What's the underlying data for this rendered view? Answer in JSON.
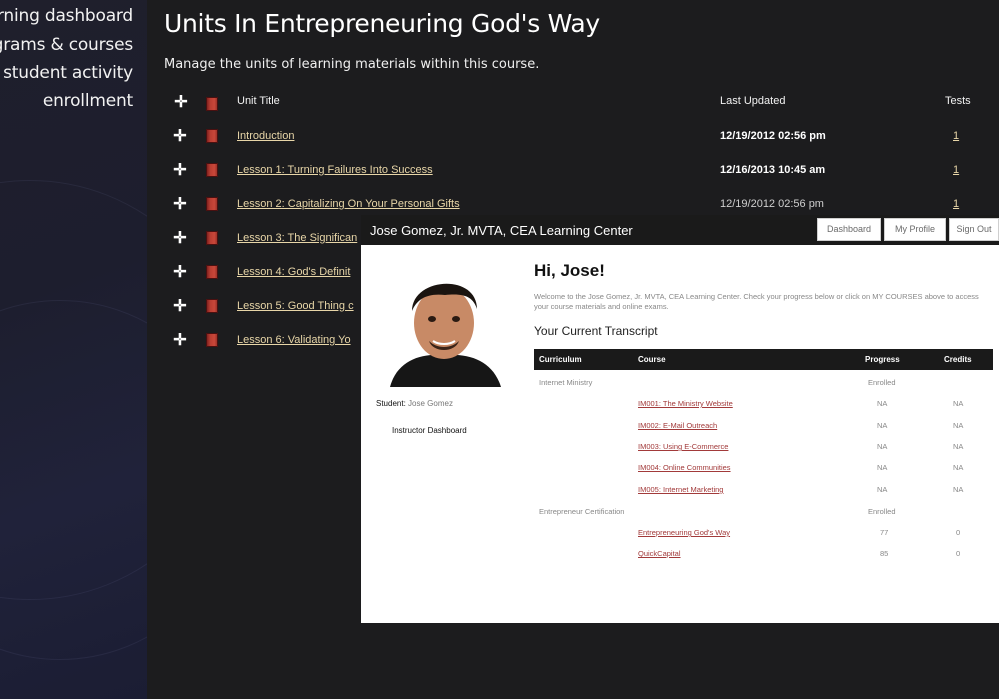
{
  "sidebar": {
    "items": [
      {
        "label": "learning dashboard"
      },
      {
        "label": "programs & courses"
      },
      {
        "label": "student activity"
      },
      {
        "label": "enrollment"
      }
    ]
  },
  "main": {
    "title": "Units In Entrepreneuring God's Way",
    "subtitle": "Manage the units of learning materials within this course.",
    "columns": {
      "unit_title": "Unit Title",
      "last_updated": "Last Updated",
      "tests": "Tests"
    },
    "units": [
      {
        "title": "Introduction",
        "updated": "12/19/2012 02:56 pm",
        "tests": "1"
      },
      {
        "title": "Lesson 1: Turning Failures Into Success",
        "updated": "12/16/2013 10:45 am",
        "tests": "1"
      },
      {
        "title": "Lesson 2: Capitalizing On Your Personal Gifts",
        "updated": "12/19/2012 02:56 pm",
        "tests": "1"
      },
      {
        "title": "Lesson 3: The Significan",
        "updated": "",
        "tests": ""
      },
      {
        "title": "Lesson 4: God's Definit",
        "updated": "",
        "tests": ""
      },
      {
        "title": "Lesson 5: Good Thing c",
        "updated": "",
        "tests": ""
      },
      {
        "title": "Lesson 6: Validating Yo",
        "updated": "",
        "tests": ""
      }
    ]
  },
  "overlay": {
    "brand": "Jose Gomez, Jr. MVTA, CEA Learning Center",
    "buttons": {
      "dashboard": "Dashboard",
      "profile": "My Profile",
      "signout": "Sign Out"
    },
    "greeting": "Hi, Jose!",
    "welcome": "Welcome to the Jose Gomez, Jr. MVTA, CEA Learning Center. Check your progress below or click on MY COURSES above to access your course materials and online exams.",
    "student_label": "Student:",
    "student_name": "Jose Gomez",
    "instructor_link": "Instructor Dashboard",
    "transcript_title": "Your Current Transcript",
    "transcript_head": {
      "curriculum": "Curriculum",
      "course": "Course",
      "progress": "Progress",
      "credits": "Credits"
    },
    "transcript": [
      {
        "curriculum": "Internet Ministry",
        "course": "",
        "progress": "Enrolled",
        "credits": ""
      },
      {
        "curriculum": "",
        "course": "IM001: The Ministry Website",
        "progress": "NA",
        "credits": "NA"
      },
      {
        "curriculum": "",
        "course": "IM002: E-Mail Outreach",
        "progress": "NA",
        "credits": "NA"
      },
      {
        "curriculum": "",
        "course": "IM003: Using E-Commerce",
        "progress": "NA",
        "credits": "NA"
      },
      {
        "curriculum": "",
        "course": "IM004: Online Communities",
        "progress": "NA",
        "credits": "NA"
      },
      {
        "curriculum": "",
        "course": "IM005: Internet Marketing",
        "progress": "NA",
        "credits": "NA"
      },
      {
        "curriculum": "Entrepreneur Certification",
        "course": "",
        "progress": "Enrolled",
        "credits": ""
      },
      {
        "curriculum": "",
        "course": "Entrepreneuring God's Way",
        "progress": "77",
        "credits": "0"
      },
      {
        "curriculum": "",
        "course": "QuickCapital",
        "progress": "85",
        "credits": "0"
      }
    ]
  },
  "colors": {
    "link_gold": "#e8d6a8",
    "course_link": "#a23a3a",
    "dark_bg": "#1c1c1e"
  }
}
